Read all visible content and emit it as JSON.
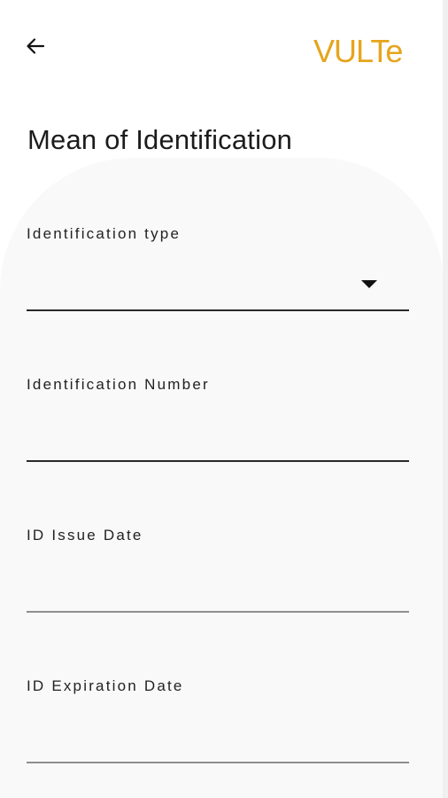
{
  "header": {
    "back_icon": "arrow-left-icon",
    "logo_text": "VULTe",
    "brand_color": "#e5a51c"
  },
  "page": {
    "title": "Mean of Identification"
  },
  "form": {
    "identification_type": {
      "label": "Identification type",
      "value": "",
      "icon": "caret-down-icon"
    },
    "identification_number": {
      "label": "Identification Number",
      "value": ""
    },
    "issue_date": {
      "label": "ID Issue Date",
      "value": ""
    },
    "expiration_date": {
      "label": "ID Expiration Date",
      "value": ""
    }
  }
}
